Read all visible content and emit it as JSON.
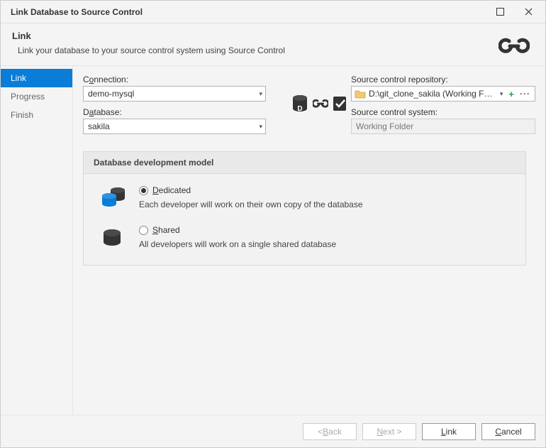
{
  "window": {
    "title": "Link Database to Source Control"
  },
  "header": {
    "title": "Link",
    "subtitle": "Link your database to your source control system using Source Control"
  },
  "sidebar": {
    "items": [
      {
        "label": "Link",
        "active": true
      },
      {
        "label": "Progress",
        "active": false
      },
      {
        "label": "Finish",
        "active": false
      }
    ]
  },
  "form": {
    "connection_label_pre": "C",
    "connection_label_ul": "o",
    "connection_label_post": "nnection:",
    "connection_value": "demo-mysql",
    "database_label_pre": "D",
    "database_label_ul": "a",
    "database_label_post": "tabase:",
    "database_value": "sakila",
    "repo_label": "Source control repository:",
    "repo_value": "D:\\git_clone_sakila (Working Folder)",
    "system_label": "Source control system:",
    "system_value": "Working Folder"
  },
  "panel": {
    "title": "Database development model",
    "dedicated": {
      "label_ul": "D",
      "label_post": "edicated",
      "desc": "Each developer will work on their own copy of the database",
      "selected": true
    },
    "shared": {
      "label_ul": "S",
      "label_post": "hared",
      "desc": "All developers will work on a single shared database",
      "selected": false
    }
  },
  "footer": {
    "back_pre": "< ",
    "back_ul": "B",
    "back_post": "ack",
    "next_ul": "N",
    "next_post": "ext >",
    "link_ul": "L",
    "link_post": "ink",
    "cancel_ul": "C",
    "cancel_post": "ancel"
  }
}
